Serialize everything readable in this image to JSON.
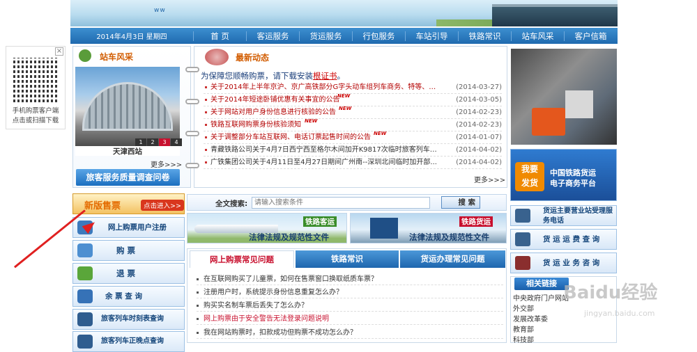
{
  "banner": {
    "logo_text": "ww"
  },
  "nav": {
    "date": "2014年4月3日 星期四",
    "items": [
      "首 页",
      "客运服务",
      "货运服务",
      "行包服务",
      "车站引导",
      "铁路常识",
      "站车风采",
      "客户信箱"
    ]
  },
  "qr": {
    "caption_line1": "手机购票客户端",
    "caption_line2": "点击或扫描下载",
    "close": "×"
  },
  "station": {
    "title": "站车风采",
    "photo_caption": "天津西站",
    "pages": [
      "1",
      "2",
      "3",
      "4"
    ],
    "more": "更多>>>"
  },
  "survey": {
    "label": "旅客服务质量调查问卷"
  },
  "news": {
    "title": "最新动态",
    "notice_prefix": "为保障您顺畅购票，请下载安装",
    "notice_link": "根证书",
    "notice_suffix": "。",
    "new_tag": "NEW",
    "items": [
      {
        "text": "关于2014年上半年京沪、京广高铁部分G字头动车组列车商务、特等、一...",
        "date": "(2014-03-27)"
      },
      {
        "text": "关于2014年短途卧铺优惠有关事宜的公告",
        "date": "(2014-03-05)"
      },
      {
        "text": "关于网站对用户身份信息进行核验的公告",
        "date": "(2014-02-23)"
      },
      {
        "text": "铁路互联网购票身份核验须知",
        "date": "(2014-02-23)"
      },
      {
        "text": "关于调整部分车站互联网、电话订票起售时间的公告",
        "date": "(2014-01-07)"
      },
      {
        "text": "青藏铁路公司关于4月7日西宁西至格尔木间加开K9817次临时旅客列车的...",
        "date": "(2014-04-02)"
      },
      {
        "text": "广铁集团公司关于4月11日至4月27日期间广州南--深圳北间临时加开部...",
        "date": "(2014-04-02)"
      }
    ],
    "more": "更多>>>"
  },
  "sidebar": {
    "new_ticketing": "新版售票",
    "click_enter": "点击进入>>",
    "buttons": [
      "网上购票用户注册",
      "购    票",
      "退    票",
      "余 票 查 询",
      "旅客列车时刻表查询",
      "旅客列车正晚点查询"
    ]
  },
  "search": {
    "label": "全文搜索:",
    "placeholder": "请输入搜索条件",
    "button": "搜 索"
  },
  "banners": {
    "passenger": {
      "title": "铁路客运",
      "subtitle": "法律法规及规范性文件"
    },
    "freight": {
      "title": "铁路货运",
      "subtitle": "法律法规及规范性文件"
    }
  },
  "faq": {
    "tabs": [
      "网上购票常见问题",
      "铁路常识",
      "货运办理常见问题"
    ],
    "items": [
      "在互联网购买了儿童票，如何在售票窗口换取纸质车票？",
      "注册用户时，系统提示身份信息重复怎么办？",
      "购买实名制车票后丢失了怎么办？",
      "网上购票由于安全警告无法登录问题说明",
      "我在网站购票时，扣款成功但购票不成功怎么办？"
    ]
  },
  "right": {
    "ecommerce_line1": "中国铁路货运",
    "ecommerce_line2": "电子商务平台",
    "fahuo_1": "我要",
    "fahuo_2": "发货",
    "buttons": [
      "货运主要营业站受理服务电话",
      "货 运 运 费 查 询",
      "货 运 业 务 咨 询"
    ],
    "links_title": "相关链接",
    "links": [
      "中央政府门户网站",
      "外交部",
      "发展改革委",
      "教育部",
      "科技部"
    ]
  },
  "watermark": {
    "brand": "Baidu经验",
    "url": "jingyan.baidu.com"
  }
}
